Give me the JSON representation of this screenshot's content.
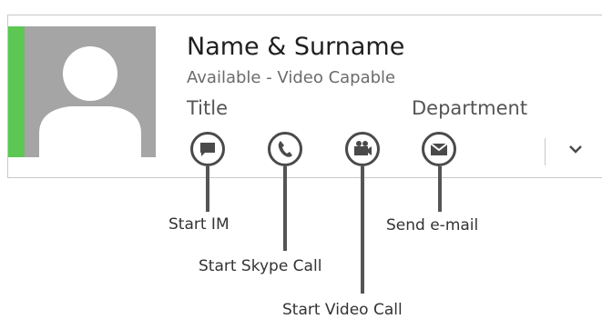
{
  "contact_card": {
    "name": "Name & Surname",
    "status": "Available - Video Capable",
    "title": "Title",
    "department": "Department",
    "presence_color": "#5cc753"
  },
  "actions": [
    {
      "icon": "chat-bubble-icon"
    },
    {
      "icon": "phone-icon"
    },
    {
      "icon": "video-camera-icon"
    },
    {
      "icon": "envelope-icon"
    }
  ],
  "callouts": {
    "start_im": "Start IM",
    "start_skype_call": "Start Skype Call",
    "start_video_call": "Start Video Call",
    "send_email": "Send e-mail"
  },
  "expand_icon": "chevron-down-icon"
}
